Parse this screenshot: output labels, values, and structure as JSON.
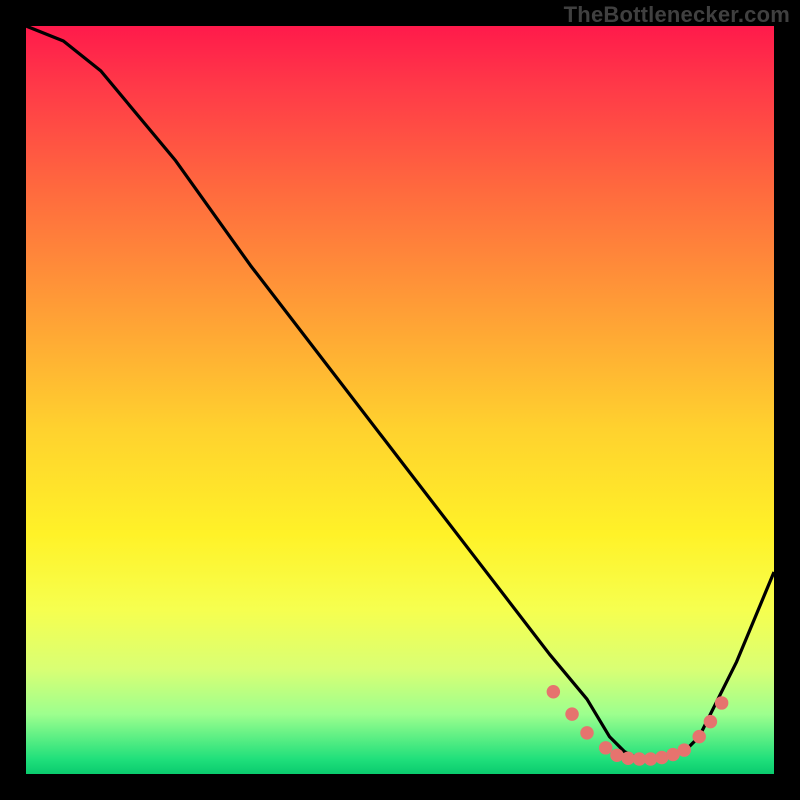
{
  "watermark": "TheBottlenecker.com",
  "colors": {
    "frame": "#000000",
    "curve": "#000000",
    "marker": "#e6736e"
  },
  "chart_data": {
    "type": "line",
    "title": "",
    "xlabel": "",
    "ylabel": "",
    "xlim": [
      0,
      100
    ],
    "ylim": [
      0,
      100
    ],
    "note": "No axis ticks or labels are visible in the image; values are estimated on a 0–100 normalized scale where y=0 is the bottom of the plot and x=0 is the left.",
    "series": [
      {
        "name": "curve",
        "x": [
          0,
          5,
          10,
          20,
          30,
          40,
          50,
          60,
          70,
          75,
          78,
          80,
          82,
          85,
          88,
          90,
          95,
          100
        ],
        "y": [
          100,
          98,
          94,
          82,
          68,
          55,
          42,
          29,
          16,
          10,
          5,
          3,
          2,
          2,
          3,
          5,
          15,
          27
        ]
      }
    ],
    "markers": {
      "name": "dots",
      "x": [
        70.5,
        73.0,
        75.0,
        77.5,
        79.0,
        80.5,
        82.0,
        83.5,
        85.0,
        86.5,
        88.0,
        90.0,
        91.5,
        93.0
      ],
      "y": [
        11.0,
        8.0,
        5.5,
        3.5,
        2.5,
        2.1,
        2.0,
        2.0,
        2.2,
        2.6,
        3.2,
        5.0,
        7.0,
        9.5
      ]
    }
  }
}
